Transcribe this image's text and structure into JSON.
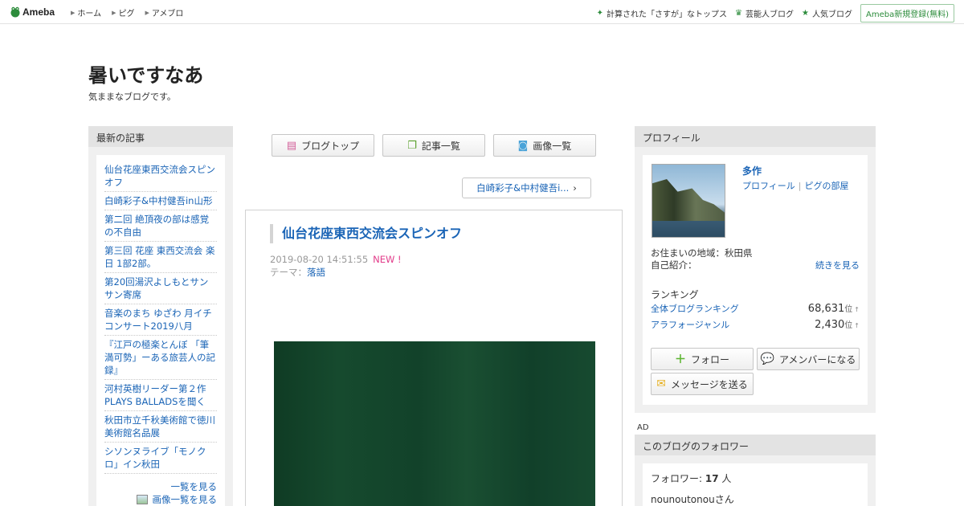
{
  "topbar": {
    "logo": "Ameba",
    "nav": [
      "ホーム",
      "ピグ",
      "アメブロ"
    ],
    "right_links": [
      "計算された「さすが」なトップス",
      "芸能人ブログ",
      "人気ブログ"
    ],
    "register": "Ameba新規登録(無料)"
  },
  "header": {
    "title": "暑いですなあ",
    "description": "気ままなブログです。"
  },
  "recent": {
    "heading": "最新の記事",
    "items": [
      "仙台花座東西交流会スピンオフ",
      "白崎彩子&中村健吾in山形",
      "第二回 絶頂夜の部は感覚の不自由",
      "第三回 花座 東西交流会 楽日 1部2部。",
      "第20回湯沢よしもとサンサン寄席",
      "音楽のまち ゆざわ 月イチコンサート2019八月",
      "『江戸の極楽とんぼ 「筆満可勢」ーある旅芸人の記録』",
      "河村英樹リーダー第２作PLAYS BALLADSを聞く",
      "秋田市立千秋美術館で徳川美術館名品展",
      "シソンヌライブ「モノクロ」イン秋田"
    ],
    "list_link": "一覧を見る",
    "image_list_link": "画像一覧を見る"
  },
  "center": {
    "buttons": [
      "ブログトップ",
      "記事一覧",
      "画像一覧"
    ],
    "next_article": "白崎彩子&中村健吾i...",
    "article": {
      "title": "仙台花座東西交流会スピンオフ",
      "date": "2019-08-20 14:51:55",
      "new_badge": "NEW !",
      "theme_label": "テーマ：",
      "theme": "落語"
    }
  },
  "profile": {
    "heading": "プロフィール",
    "name": "多作",
    "profile_link": "プロフィール",
    "pigg_link": "ピグの部屋",
    "location_label": "お住まいの地域：秋田県",
    "intro_label": "自己紹介：",
    "more": "続きを見る",
    "ranking_heading": "ランキング",
    "rankings": [
      {
        "label": "全体ブログランキング",
        "value": "68,631",
        "unit": "位",
        "arrow": "↑"
      },
      {
        "label": "アラフォージャンル",
        "value": "2,430",
        "unit": "位",
        "arrow": "↑"
      }
    ],
    "follow": "フォロー",
    "amember": "アメンバーになる",
    "message": "メッセージを送る"
  },
  "ad_label": "AD",
  "followers": {
    "heading": "このブログのフォロワー",
    "label": "フォロワー:",
    "count": "17",
    "unit": "人",
    "first": "nounoutonouさん"
  }
}
